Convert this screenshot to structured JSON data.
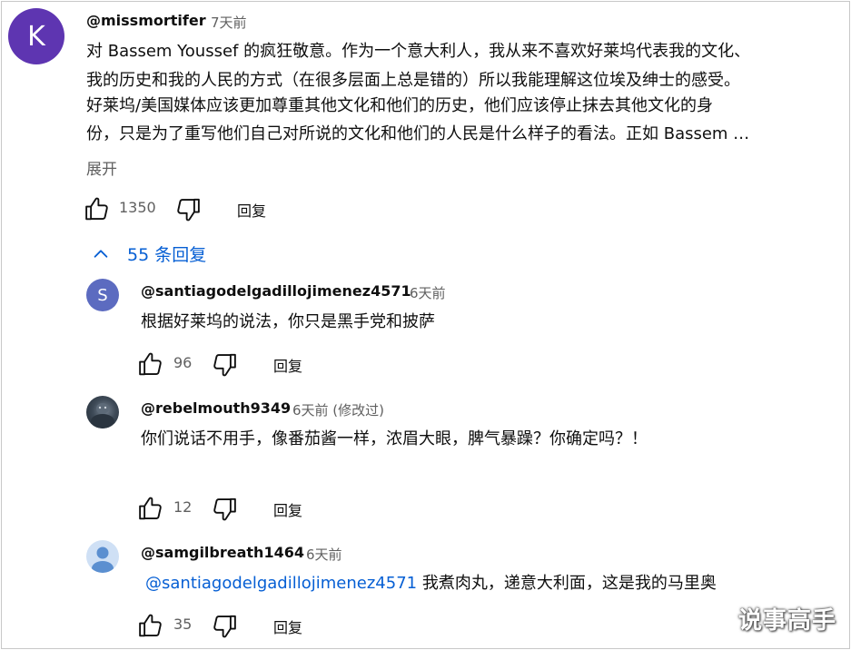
{
  "comment": {
    "avatar_letter": "K",
    "author": "@missmortifer",
    "time": "7天前",
    "lines": [
      "对 Bassem Youssef 的疯狂敬意。作为一个意大利人，我从来不喜欢好莱坞代表我的文化、",
      "我的历史和我的人民的方式（在很多层面上总是错的）所以我能理解这位埃及绅士的感受。",
      "好莱坞/美国媒体应该更加尊重其他文化和他们的历史，他们应该停止抹去其他文化的身",
      "份，只是为了重写他们自己对所说的文化和他们的人民是什么样子的看法。正如 Bassem …"
    ],
    "expand_label": "展开",
    "likes": "1350",
    "reply_label": "回复"
  },
  "replies_toggle": {
    "chevron": "chevron-up-icon",
    "label": "55 条回复"
  },
  "replies": [
    {
      "avatar_letter": "S",
      "author": "@santiagodelgadillojimenez4571",
      "time": "6天前",
      "text": "根据好莱坞的说法，你只是黑手党和披萨",
      "likes": "96",
      "reply_label": "回复"
    },
    {
      "author": "@rebelmouth9349",
      "time": "6天前 (修改过)",
      "text": "你们说话不用手，像番茄酱一样，浓眉大眼，脾气暴躁？你确定吗？！",
      "likes": "12",
      "reply_label": "回复"
    },
    {
      "author": "@samgilbreath1464",
      "time": "6天前",
      "mention": "@santiagodelgadillojimenez4571",
      "text": "我煮肉丸，递意大利面，这是我的马里奥",
      "likes": "35",
      "reply_label": "回复"
    }
  ],
  "watermark": "说事高手",
  "colors": {
    "link_blue": "#065fd4",
    "secondary_text": "#606060",
    "avatar_main": "#5e35b1",
    "avatar_s": "#5c6bc0"
  }
}
